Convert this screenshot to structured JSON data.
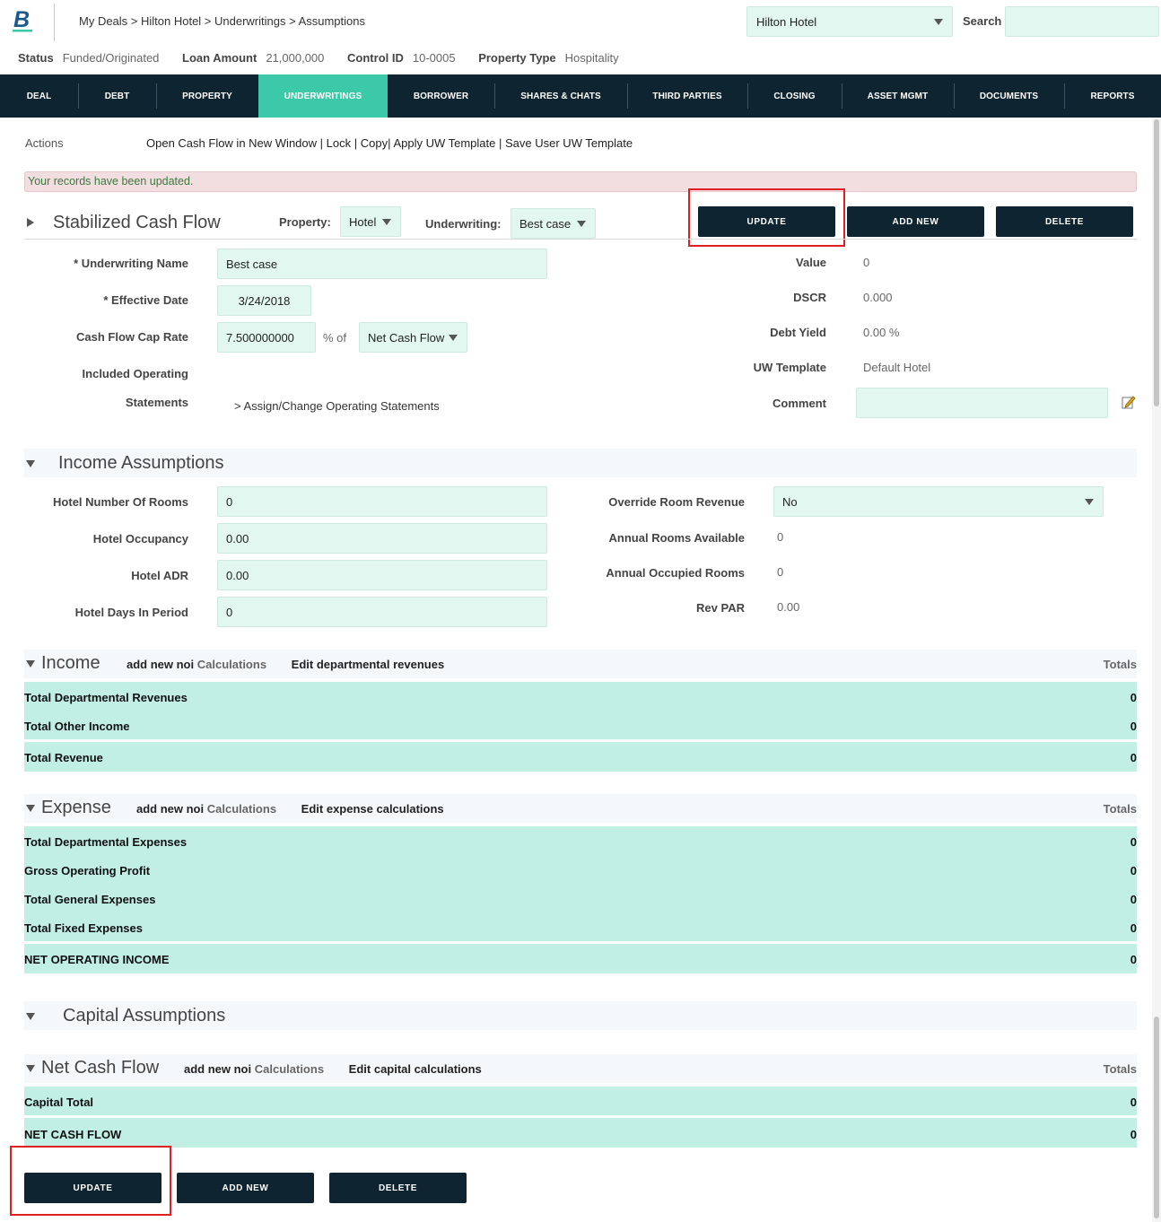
{
  "header": {
    "breadcrumb": "My Deals > Hilton Hotel > Underwritings > Assumptions",
    "deal_select": "Hilton Hotel",
    "search_label": "Search",
    "search_value": ""
  },
  "infobar": {
    "status_label": "Status",
    "status_value": "Funded/Originated",
    "loan_label": "Loan Amount",
    "loan_value": "21,000,000",
    "control_label": "Control ID",
    "control_value": "10-0005",
    "ptype_label": "Property Type",
    "ptype_value": "Hospitality"
  },
  "nav": {
    "items": [
      "DEAL",
      "DEBT",
      "PROPERTY",
      "UNDERWRITINGS",
      "BORROWER",
      "SHARES & CHATS",
      "THIRD PARTIES",
      "CLOSING",
      "ASSET MGMT",
      "DOCUMENTS",
      "REPORTS"
    ],
    "active": "UNDERWRITINGS"
  },
  "actions": {
    "label": "Actions",
    "open_cash_flow": "Open Cash Flow in New Window",
    "lock": "Lock",
    "copy": "Copy",
    "apply_template": "Apply UW Template",
    "save_template": "Save User UW Template",
    "sep": "|"
  },
  "alert": "Your records have been updated.",
  "buttons": {
    "update": "UPDATE",
    "add_new": "ADD NEW",
    "delete": "DELETE"
  },
  "stabilized": {
    "title": "Stabilized Cash Flow",
    "property_label": "Property:",
    "property_value": "Hotel",
    "underwriting_label": "Underwriting:",
    "underwriting_value": "Best case",
    "uw_name_label": "* Underwriting Name",
    "uw_name_value": "Best case",
    "eff_date_label": "* Effective Date",
    "eff_date_value": "3/24/2018",
    "cap_rate_label": "Cash Flow Cap Rate",
    "cap_rate_value": "7.500000000",
    "pct_of": "% of",
    "cap_basis": "Net Cash Flow",
    "included_label_1": "Included Operating",
    "included_label_2": "Statements",
    "assign_link": "> Assign/Change Operating Statements",
    "value_label": "Value",
    "value_value": "0",
    "dscr_label": "DSCR",
    "dscr_value": "0.000",
    "debt_yield_label": "Debt Yield",
    "debt_yield_value": "0.00 %",
    "uw_template_label": "UW Template",
    "uw_template_value": "Default Hotel",
    "comment_label": "Comment",
    "comment_value": ""
  },
  "income_assumptions": {
    "title": "Income Assumptions",
    "rooms_label": "Hotel Number Of Rooms",
    "rooms_value": "0",
    "occupancy_label": "Hotel Occupancy",
    "occupancy_value": "0.00",
    "adr_label": "Hotel ADR",
    "adr_value": "0.00",
    "days_label": "Hotel Days In Period",
    "days_value": "0",
    "override_label": "Override Room Revenue",
    "override_value": "No",
    "annual_avail_label": "Annual Rooms Available",
    "annual_avail_value": "0",
    "annual_occ_label": "Annual Occupied Rooms",
    "annual_occ_value": "0",
    "revpar_label": "Rev PAR",
    "revpar_value": "0.00"
  },
  "income": {
    "title": "Income",
    "add_new": "add new noi",
    "calculations": "Calculations",
    "edit_link": "Edit departmental revenues",
    "totals": "Totals",
    "rows": [
      {
        "name": "Total Departmental Revenues",
        "value": "0"
      },
      {
        "name": "Total Other Income",
        "value": "0"
      },
      {
        "name": "Total Revenue",
        "value": "0"
      }
    ]
  },
  "expense": {
    "title": "Expense",
    "add_new": "add new noi",
    "calculations": "Calculations",
    "edit_link": "Edit expense calculations",
    "totals": "Totals",
    "rows": [
      {
        "name": "Total Departmental Expenses",
        "value": "0"
      },
      {
        "name": "Gross Operating Profit",
        "value": "0"
      },
      {
        "name": "Total General Expenses",
        "value": "0"
      },
      {
        "name": "Total Fixed Expenses",
        "value": "0"
      },
      {
        "name": "NET OPERATING INCOME",
        "value": "0"
      }
    ]
  },
  "capital_assumptions": {
    "title": "Capital Assumptions"
  },
  "net_cash_flow": {
    "title": "Net Cash Flow",
    "add_new": "add new noi",
    "calculations": "Calculations",
    "edit_link": "Edit capital calculations",
    "totals": "Totals",
    "rows": [
      {
        "name": "Capital Total",
        "value": "0"
      },
      {
        "name": "NET CASH FLOW",
        "value": "0"
      }
    ]
  },
  "colors": {
    "nav_bg": "#0f2431",
    "nav_active": "#3cc9a8",
    "field_bg": "#e3f7f1",
    "row_bg": "#c2efe4",
    "highlight": "#e02020"
  }
}
